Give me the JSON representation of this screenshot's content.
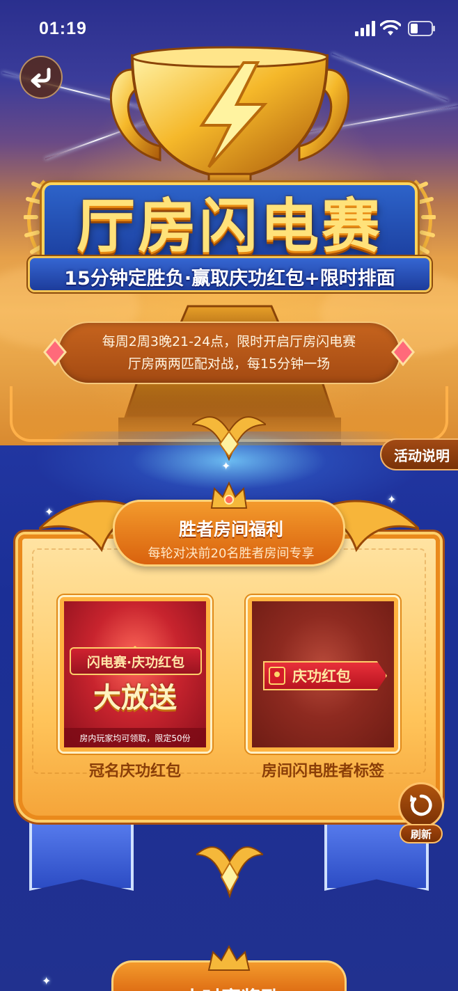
{
  "status_bar": {
    "time": "01:19"
  },
  "hero": {
    "title": "厅房闪电赛",
    "subtitle": "15分钟定胜负·赢取庆功红包+限时排面",
    "info_lines": [
      "每周2周3晚21-24点，限时开启厅房闪电赛",
      "厅房两两匹配对战，每15分钟一场"
    ]
  },
  "rules_button": {
    "label": "活动说明"
  },
  "benefits": {
    "title": "胜者房间福利",
    "subtitle": "每轮对决前20名胜者房间专享",
    "cards": [
      {
        "title_line": "闪电赛·庆功红包",
        "big_text": "大放送",
        "note": "房内玩家均可领取，限定50份",
        "label": "冠名庆功红包"
      },
      {
        "tag_text": "庆功红包",
        "label": "房间闪电胜者标签"
      }
    ]
  },
  "refresh": {
    "label": "刷新"
  },
  "next_section": {
    "title": "小时赛奖励"
  },
  "colors": {
    "accent_gold": "#ffd45a",
    "accent_orange": "#d9620e",
    "brand_blue": "#1b3e9e",
    "card_label": "#8a3e08"
  }
}
